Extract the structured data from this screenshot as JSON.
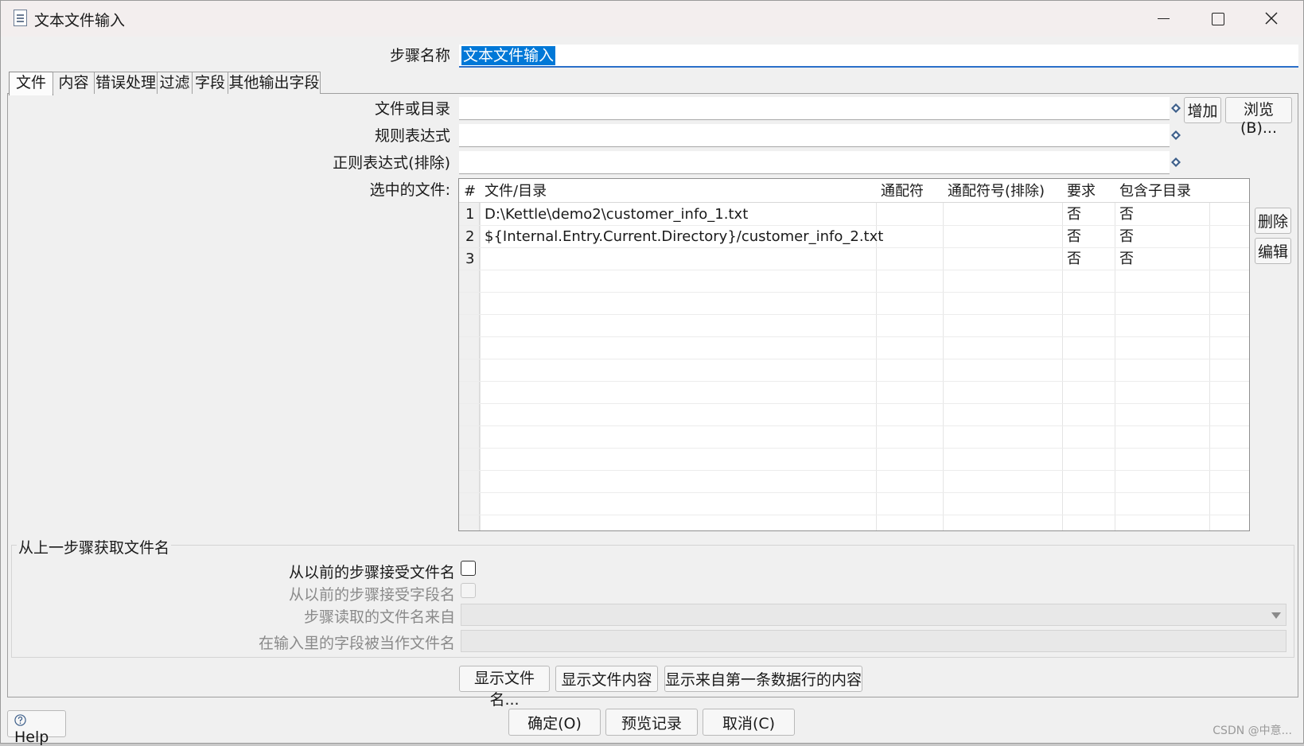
{
  "window": {
    "title": "文本文件输入"
  },
  "step": {
    "label": "步骤名称",
    "value": "文本文件输入"
  },
  "tabs": [
    "文件",
    "内容",
    "错误处理",
    "过滤",
    "字段",
    "其他输出字段"
  ],
  "file_section": {
    "file_or_dir_label": "文件或目录",
    "regex_label": "规则表达式",
    "regex_exclude_label": "正则表达式(排除)",
    "selected_files_label": "选中的文件:",
    "add_button": "增加",
    "browse_button": "浏览(B)...",
    "delete_button": "删除",
    "edit_button": "编辑"
  },
  "grid": {
    "columns": [
      "#",
      "文件/目录",
      "通配符",
      "通配符号(排除)",
      "要求",
      "包含子目录"
    ],
    "rows": [
      {
        "num": "1",
        "path": "D:\\Kettle\\demo2\\customer_info_1.txt",
        "wildcard": "",
        "wildcard_ex": "",
        "required": "否",
        "subdirs": "否"
      },
      {
        "num": "2",
        "path": "${Internal.Entry.Current.Directory}/customer_info_2.txt",
        "wildcard": "",
        "wildcard_ex": "",
        "required": "否",
        "subdirs": "否"
      },
      {
        "num": "3",
        "path": "",
        "wildcard": "",
        "wildcard_ex": "",
        "required": "否",
        "subdirs": "否"
      }
    ]
  },
  "prev_step_group": {
    "title": "从上一步骤获取文件名",
    "accept_filenames_label": "从以前的步骤接受文件名",
    "accept_fieldname_label": "从以前的步骤接受字段名",
    "step_source_label": "步骤读取的文件名来自",
    "field_as_filename_label": "在输入里的字段被当作文件名"
  },
  "bottom_buttons": {
    "show_filenames": "显示文件名...",
    "show_content": "显示文件内容",
    "show_first_row": "显示来自第一条数据行的内容"
  },
  "footer": {
    "help": "Help",
    "ok": "确定(O)",
    "preview": "预览记录",
    "cancel": "取消(C)"
  },
  "watermark": "CSDN @中意..."
}
